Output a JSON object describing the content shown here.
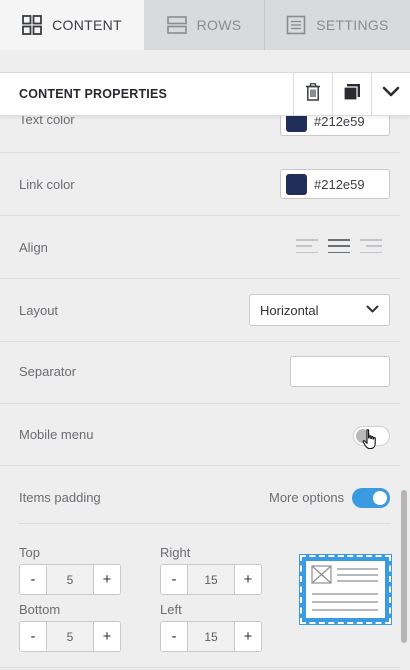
{
  "tabs": [
    {
      "label": "CONTENT",
      "icon": "grid-icon",
      "active": true
    },
    {
      "label": "ROWS",
      "icon": "rows-icon",
      "active": false
    },
    {
      "label": "SETTINGS",
      "icon": "settings-page-icon",
      "active": false
    }
  ],
  "section": {
    "title": "CONTENT PROPERTIES",
    "actions": [
      "trash-icon",
      "duplicate-icon",
      "chevron-down-icon"
    ]
  },
  "properties": {
    "text_color": {
      "label": "Text color",
      "value": "#212e59",
      "swatch": "#212e59"
    },
    "link_color": {
      "label": "Link color",
      "value": "#212e59",
      "swatch": "#212e59"
    },
    "align": {
      "label": "Align",
      "options": [
        "left",
        "center",
        "right"
      ],
      "selected": "center"
    },
    "layout": {
      "label": "Layout",
      "value": "Horizontal"
    },
    "separator": {
      "label": "Separator",
      "value": ""
    },
    "mobile_menu": {
      "label": "Mobile menu",
      "enabled": false
    },
    "items_padding": {
      "label": "Items padding",
      "more_options_label": "More options",
      "more_options_enabled": true
    }
  },
  "padding": {
    "top": {
      "label": "Top",
      "value": "5"
    },
    "right": {
      "label": "Right",
      "value": "15"
    },
    "bottom": {
      "label": "Bottom",
      "value": "5"
    },
    "left": {
      "label": "Left",
      "value": "15"
    },
    "minus": "-",
    "plus": "+"
  },
  "colors": {
    "accent": "#3a9be0",
    "swatch": "#212e59"
  }
}
